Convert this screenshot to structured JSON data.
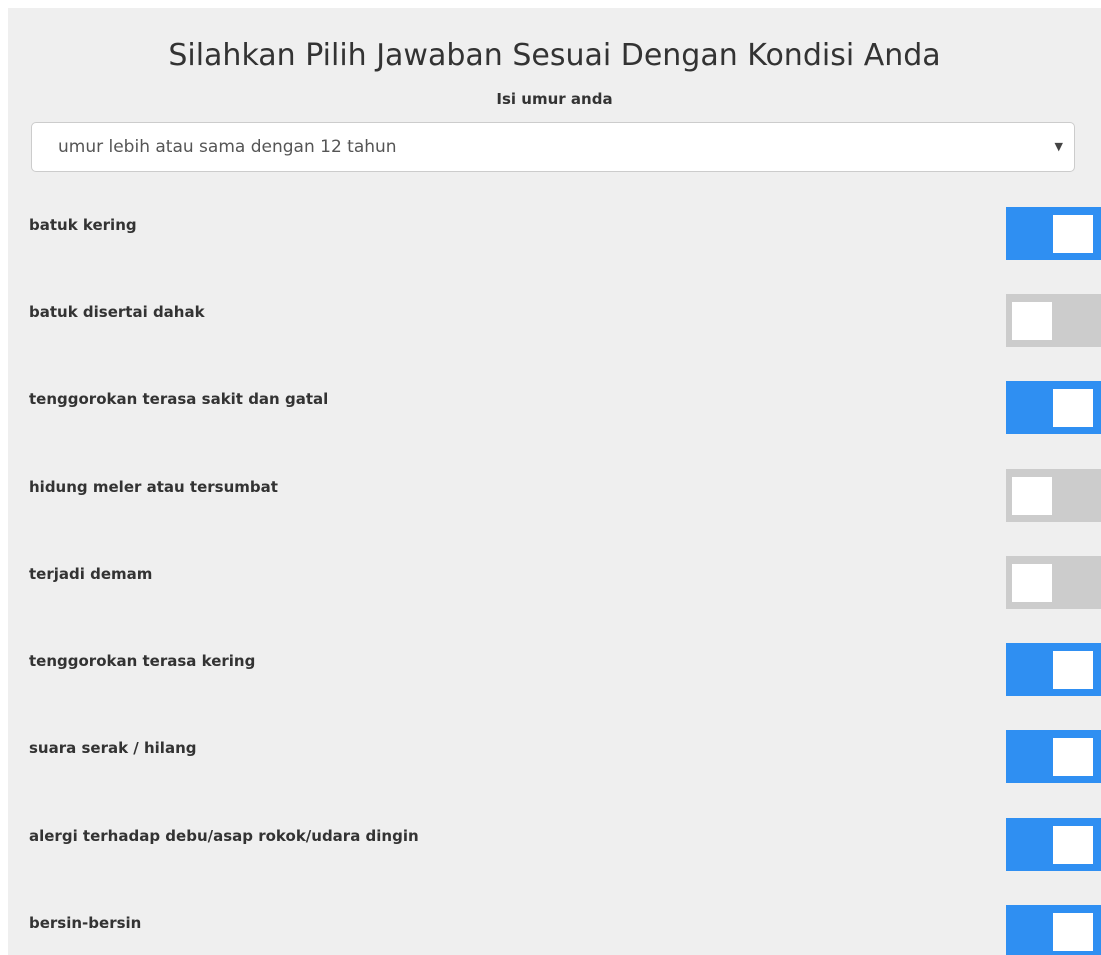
{
  "form": {
    "title": "Silahkan Pilih Jawaban Sesuai Dengan Kondisi Anda",
    "age_label": "Isi umur anda",
    "age_select": {
      "value": "umur lebih atau sama dengan 12 tahun",
      "caret_icon": "caret-down-icon"
    }
  },
  "colors": {
    "toggle_on": "#2f8ff2",
    "toggle_off": "#cccccc",
    "background": "#efefef"
  },
  "questions": [
    {
      "label": "batuk kering",
      "checked": true
    },
    {
      "label": "batuk disertai dahak",
      "checked": false
    },
    {
      "label": "tenggorokan terasa sakit dan gatal",
      "checked": true
    },
    {
      "label": "hidung meler atau tersumbat",
      "checked": false
    },
    {
      "label": "terjadi demam",
      "checked": false
    },
    {
      "label": "tenggorokan terasa kering",
      "checked": true
    },
    {
      "label": "suara serak / hilang",
      "checked": true
    },
    {
      "label": "alergi terhadap debu/asap rokok/udara dingin",
      "checked": true
    },
    {
      "label": "bersin-bersin",
      "checked": true
    }
  ]
}
